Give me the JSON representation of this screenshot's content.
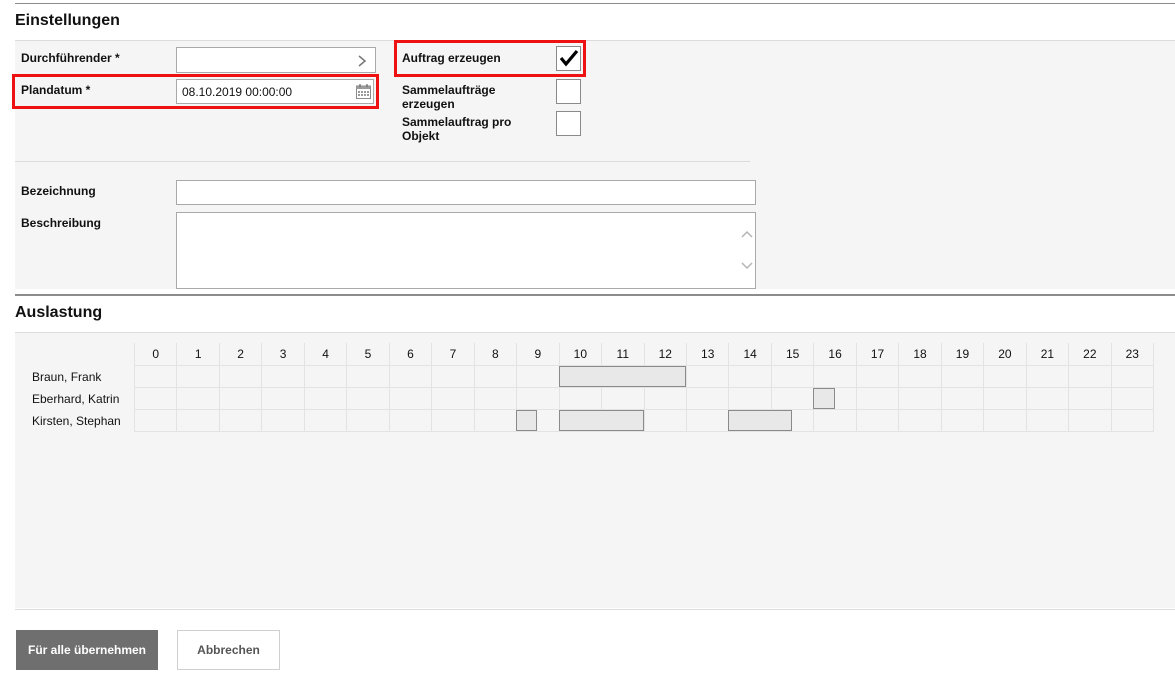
{
  "settings": {
    "title": "Einstellungen",
    "durchfuehrender_label": "Durchführender *",
    "durchfuehrender_value": "",
    "plandatum_label": "Plandatum *",
    "plandatum_value": "08.10.2019 00:00:00",
    "auftrag_label": "Auftrag erzeugen",
    "auftrag_checked": true,
    "sammel_label_1": "Sammelaufträge",
    "sammel_label_2": "erzeugen",
    "sammel_checked": false,
    "sammel_objekt_label_1": "Sammelauftrag pro",
    "sammel_objekt_label_2": "Objekt",
    "sammel_objekt_checked": false,
    "bezeichnung_label": "Bezeichnung",
    "bezeichnung_value": "",
    "beschreibung_label": "Beschreibung",
    "beschreibung_value": ""
  },
  "auslastung": {
    "title": "Auslastung",
    "hours": [
      "0",
      "1",
      "2",
      "3",
      "4",
      "5",
      "6",
      "7",
      "8",
      "9",
      "10",
      "11",
      "12",
      "13",
      "14",
      "15",
      "16",
      "17",
      "18",
      "19",
      "20",
      "21",
      "22",
      "23"
    ],
    "people": [
      {
        "name": "Braun, Frank",
        "bookings": [
          [
            10,
            13
          ]
        ]
      },
      {
        "name": "Eberhard, Katrin",
        "bookings": [
          [
            16,
            16.5
          ]
        ]
      },
      {
        "name": "Kirsten, Stephan",
        "bookings": [
          [
            9,
            9.5
          ],
          [
            10,
            12
          ],
          [
            14,
            15.5
          ]
        ]
      }
    ]
  },
  "buttons": {
    "apply_all": "Für alle übernehmen",
    "cancel": "Abbrechen"
  }
}
